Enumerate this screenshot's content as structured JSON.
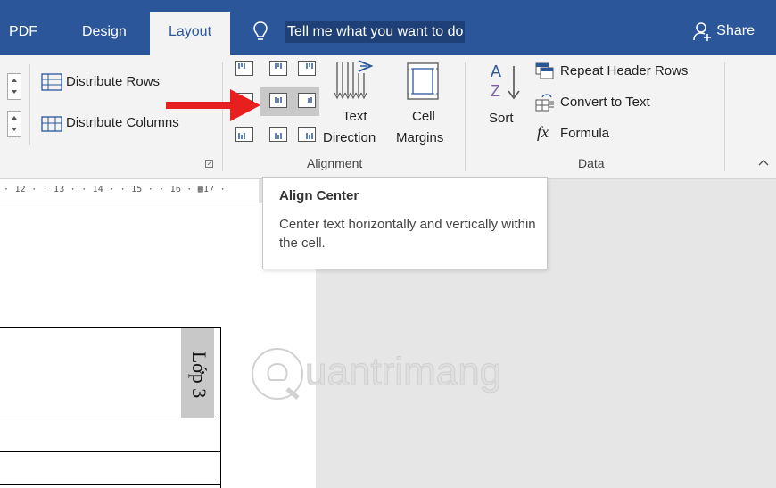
{
  "tabs": {
    "pdf": "PDF",
    "design": "Design",
    "layout": "Layout"
  },
  "tell_me": "Tell me what you want to do",
  "share": "Share",
  "ribbon": {
    "distribute_rows": "Distribute Rows",
    "distribute_columns": "Distribute Columns",
    "text_direction": [
      "Text",
      "Direction"
    ],
    "cell_margins": [
      "Cell",
      "Margins"
    ],
    "sort": "Sort",
    "repeat_header_rows": "Repeat Header Rows",
    "convert_to_text": "Convert to Text",
    "formula": "Formula",
    "alignment_group": "Alignment",
    "data_group": "Data",
    "fx": "fx"
  },
  "ruler": "· 12 ·  · 13 ·  · 14 ·  · 15 ·  · 16 · ▦17 ·",
  "tooltip": {
    "title": "Align Center",
    "body": "Center text horizontally and vertically within the cell."
  },
  "table": {
    "cell_text": "Lớp 3"
  },
  "watermark": "uantrimang",
  "colors": {
    "tabbar": "#2b579a",
    "arrow": "#e81f1f",
    "selected": "#c8c8c8"
  }
}
